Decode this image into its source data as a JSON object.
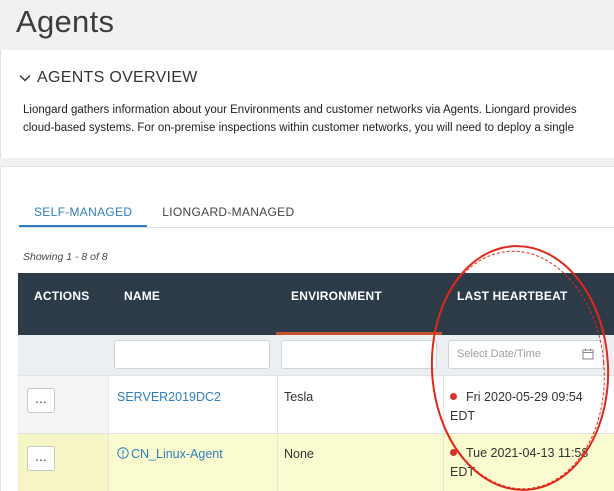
{
  "page_title": "Agents",
  "overview": {
    "heading": "AGENTS OVERVIEW",
    "line1": "Liongard gathers information about your Environments and customer networks via Agents. Liongard provides",
    "line2": "cloud-based systems. For on-premise inspections within customer networks, you will need to deploy a single"
  },
  "tabs": [
    "SELF-MANAGED",
    "LIONGARD-MANAGED"
  ],
  "showing": "Showing 1 - 8 of 8",
  "columns": {
    "actions": "ACTIONS",
    "name": "NAME",
    "environment": "ENVIRONMENT",
    "last_heartbeat": "LAST HEARTBEAT"
  },
  "filters": {
    "date_placeholder": "Select Date/Time"
  },
  "rows": [
    {
      "actions": "...",
      "name": "SERVER2019DC2",
      "environment": "Tesla",
      "heartbeat_line1": "Fri 2020-05-29 09:54",
      "heartbeat_line2": "EDT",
      "warning": false
    },
    {
      "actions": "...",
      "name": "CN_Linux-Agent",
      "environment": "None",
      "heartbeat_line1": "Tue 2021-04-13 11:58",
      "heartbeat_line2": "EDT",
      "warning": true
    }
  ],
  "colors": {
    "header_bg": "#2d3a48",
    "link": "#2f7dbf",
    "sort_accent": "#c8522e",
    "status_dot": "#d9342b",
    "warn_row": "#fbfbd0",
    "annotation": "#e0291a"
  }
}
